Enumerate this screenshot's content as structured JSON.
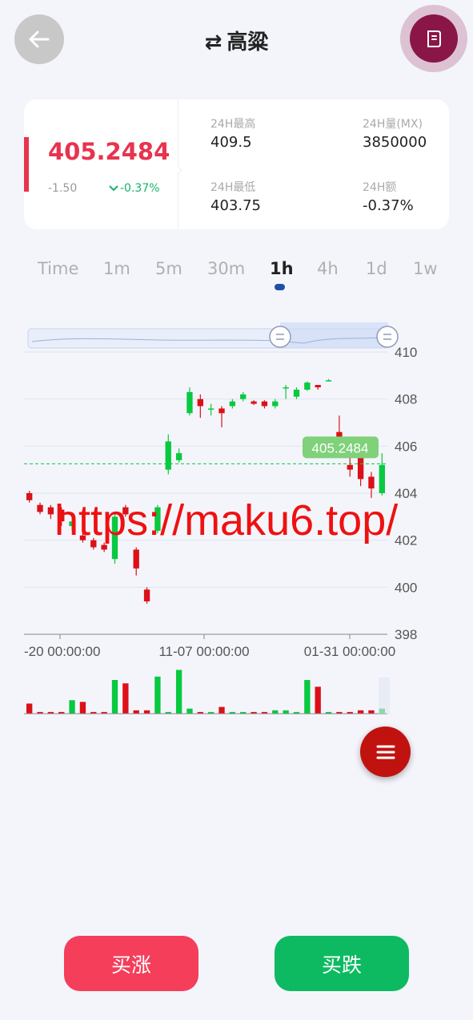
{
  "header": {
    "title": "高粱",
    "swap_glyph": "⇄",
    "back_icon": "arrow-left-icon",
    "order_icon": "document-icon"
  },
  "quote": {
    "price": "405.2484",
    "change": "-1.50",
    "change_pct": "-0.37%",
    "stats": {
      "high_label": "24H最高",
      "high_value": "409.5",
      "volume_label": "24H量(MX)",
      "volume_value": "3850000",
      "low_label": "24H最低",
      "low_value": "403.75",
      "amount_label": "24H额",
      "amount_value": "-0.37%"
    }
  },
  "tabs": [
    "Time",
    "1m",
    "5m",
    "30m",
    "1h",
    "4h",
    "1d",
    "1w"
  ],
  "active_tab": "1h",
  "chart_data": {
    "type": "candlestick",
    "y_ticks": [
      "410",
      "408",
      "406",
      "404",
      "402",
      "400",
      "398"
    ],
    "ylim": [
      398,
      410
    ],
    "x_tick_labels": [
      "-20 00:00:00",
      "11-07 00:00:00",
      "01-31 00:00:00"
    ],
    "last_price_label": "405.2484",
    "last_price": 405.2484,
    "candles": [
      {
        "o": 404.0,
        "c": 403.7,
        "h": 404.1,
        "l": 403.6,
        "v": 0.3
      },
      {
        "o": 403.5,
        "c": 403.2,
        "h": 403.6,
        "l": 403.1,
        "v": 0.05
      },
      {
        "o": 403.4,
        "c": 403.1,
        "h": 403.5,
        "l": 402.9,
        "v": 0.05
      },
      {
        "o": 403.3,
        "c": 402.8,
        "h": 403.4,
        "l": 402.6,
        "v": 0.05
      },
      {
        "o": 402.6,
        "c": 402.8,
        "h": 403.0,
        "l": 402.4,
        "v": 0.4
      },
      {
        "o": 402.2,
        "c": 402.0,
        "h": 402.4,
        "l": 401.9,
        "v": 0.35
      },
      {
        "o": 402.0,
        "c": 401.7,
        "h": 402.1,
        "l": 401.6,
        "v": 0.05
      },
      {
        "o": 401.8,
        "c": 401.6,
        "h": 401.9,
        "l": 401.5,
        "v": 0.05
      },
      {
        "o": 401.2,
        "c": 403.0,
        "h": 403.2,
        "l": 401.0,
        "v": 1.0
      },
      {
        "o": 403.4,
        "c": 403.1,
        "h": 403.5,
        "l": 403.0,
        "v": 0.9
      },
      {
        "o": 401.6,
        "c": 400.8,
        "h": 401.7,
        "l": 400.5,
        "v": 0.1
      },
      {
        "o": 399.9,
        "c": 399.4,
        "h": 400.0,
        "l": 399.3,
        "v": 0.1
      },
      {
        "o": 402.4,
        "c": 403.4,
        "h": 403.5,
        "l": 402.3,
        "v": 1.1
      },
      {
        "o": 405.0,
        "c": 406.2,
        "h": 406.5,
        "l": 404.8,
        "v": 0.05
      },
      {
        "o": 405.4,
        "c": 405.7,
        "h": 405.9,
        "l": 405.3,
        "v": 1.3
      },
      {
        "o": 407.4,
        "c": 408.3,
        "h": 408.5,
        "l": 407.3,
        "v": 0.15
      },
      {
        "o": 408.0,
        "c": 407.7,
        "h": 408.2,
        "l": 407.2,
        "v": 0.05
      },
      {
        "o": 407.6,
        "c": 407.6,
        "h": 407.8,
        "l": 407.3,
        "v": 0.05
      },
      {
        "o": 407.6,
        "c": 407.4,
        "h": 407.7,
        "l": 406.8,
        "v": 0.2
      },
      {
        "o": 407.7,
        "c": 407.9,
        "h": 408.0,
        "l": 407.6,
        "v": 0.05
      },
      {
        "o": 408.0,
        "c": 408.2,
        "h": 408.3,
        "l": 407.9,
        "v": 0.05
      },
      {
        "o": 407.9,
        "c": 407.8,
        "h": 407.95,
        "l": 407.75,
        "v": 0.05
      },
      {
        "o": 407.9,
        "c": 407.7,
        "h": 407.95,
        "l": 407.6,
        "v": 0.05
      },
      {
        "o": 407.7,
        "c": 407.9,
        "h": 408.0,
        "l": 407.6,
        "v": 0.1
      },
      {
        "o": 408.5,
        "c": 408.5,
        "h": 408.6,
        "l": 408.0,
        "v": 0.1
      },
      {
        "o": 408.1,
        "c": 408.4,
        "h": 408.5,
        "l": 408.0,
        "v": 0.05
      },
      {
        "o": 408.4,
        "c": 408.7,
        "h": 408.75,
        "l": 408.35,
        "v": 1.0
      },
      {
        "o": 408.6,
        "c": 408.5,
        "h": 408.6,
        "l": 408.4,
        "v": 0.8
      },
      {
        "o": 408.8,
        "c": 408.8,
        "h": 408.85,
        "l": 408.75,
        "v": 0.05
      },
      {
        "o": 406.6,
        "c": 406.2,
        "h": 407.3,
        "l": 406.1,
        "v": 0.05
      },
      {
        "o": 405.2,
        "c": 405.0,
        "h": 405.5,
        "l": 404.7,
        "v": 0.05
      },
      {
        "o": 405.5,
        "c": 404.6,
        "h": 405.6,
        "l": 404.3,
        "v": 0.1
      },
      {
        "o": 404.7,
        "c": 404.2,
        "h": 404.9,
        "l": 403.8,
        "v": 0.1
      },
      {
        "o": 404.0,
        "c": 405.2,
        "h": 405.7,
        "l": 403.9,
        "v": 0.15
      }
    ]
  },
  "buttons": {
    "buy_up": "买涨",
    "buy_down": "买跌"
  },
  "watermark": "https://maku6.top/",
  "colors": {
    "up": "#09c940",
    "down": "#dc1018",
    "price": "#e8334f",
    "pct": "#17b26a",
    "order_button": "#8a1648",
    "menu_fab": "#c0130f"
  }
}
